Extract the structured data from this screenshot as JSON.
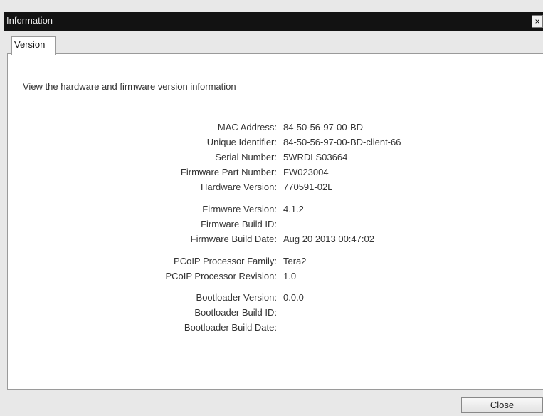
{
  "window": {
    "title": "Information",
    "close_glyph": "×"
  },
  "tabs": [
    {
      "label": "Version"
    }
  ],
  "intro": "View the hardware and firmware version information",
  "groups": [
    [
      {
        "label": "MAC Address:",
        "value": "84-50-56-97-00-BD"
      },
      {
        "label": "Unique Identifier:",
        "value": "84-50-56-97-00-BD-client-66"
      },
      {
        "label": "Serial Number:",
        "value": "5WRDLS03664"
      },
      {
        "label": "Firmware Part Number:",
        "value": "FW023004"
      },
      {
        "label": "Hardware Version:",
        "value": "770591-02L"
      }
    ],
    [
      {
        "label": "Firmware Version:",
        "value": "4.1.2"
      },
      {
        "label": "Firmware Build ID:",
        "value": ""
      },
      {
        "label": "Firmware Build Date:",
        "value": "Aug 20 2013 00:47:02"
      }
    ],
    [
      {
        "label": "PCoIP Processor Family:",
        "value": "Tera2"
      },
      {
        "label": "PCoIP Processor Revision:",
        "value": "1.0"
      }
    ],
    [
      {
        "label": "Bootloader Version:",
        "value": "0.0.0"
      },
      {
        "label": "Bootloader Build ID:",
        "value": ""
      },
      {
        "label": "Bootloader Build Date:",
        "value": ""
      }
    ]
  ],
  "footer": {
    "close_label": "Close"
  }
}
